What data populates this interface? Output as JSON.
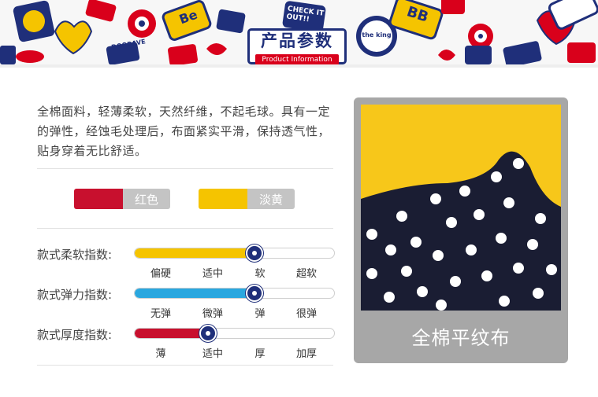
{
  "header": {
    "title": "产品参数",
    "subtitle": "Product Information",
    "sticker_texts": [
      "CHECK IT OUT!!",
      "Be",
      "the king",
      "BB",
      "DOORAVE"
    ]
  },
  "description": "全棉面料，轻薄柔软，天然纤维，不起毛球。具有一定的弹性，经蚀毛处理后，布面紧实平滑，保持透气性，贴身穿着无比舒适。",
  "colors": [
    {
      "name": "红色",
      "hex": "#c8102e"
    },
    {
      "name": "淡黄",
      "hex": "#f5c400"
    }
  ],
  "ratings": [
    {
      "label": "款式柔软指数:",
      "level": 0.6,
      "color": "#f5c400",
      "ticks": [
        "偏硬",
        "适中",
        "软",
        "超软"
      ]
    },
    {
      "label": "款式弹力指数:",
      "level": 0.6,
      "color": "#2aa7df",
      "ticks": [
        "无弹",
        "微弹",
        "弹",
        "很弹"
      ]
    },
    {
      "label": "款式厚度指数:",
      "level": 0.37,
      "color": "#c8102e",
      "ticks": [
        "薄",
        "适中",
        "厚",
        "加厚"
      ]
    }
  ],
  "fabric": {
    "caption": "全棉平纹布",
    "yellow": "#f7c71a",
    "navy": "#1a1d33",
    "dot": "#ffffff"
  },
  "theme": {
    "navy": "#1f2f7a",
    "red": "#d9001b"
  }
}
